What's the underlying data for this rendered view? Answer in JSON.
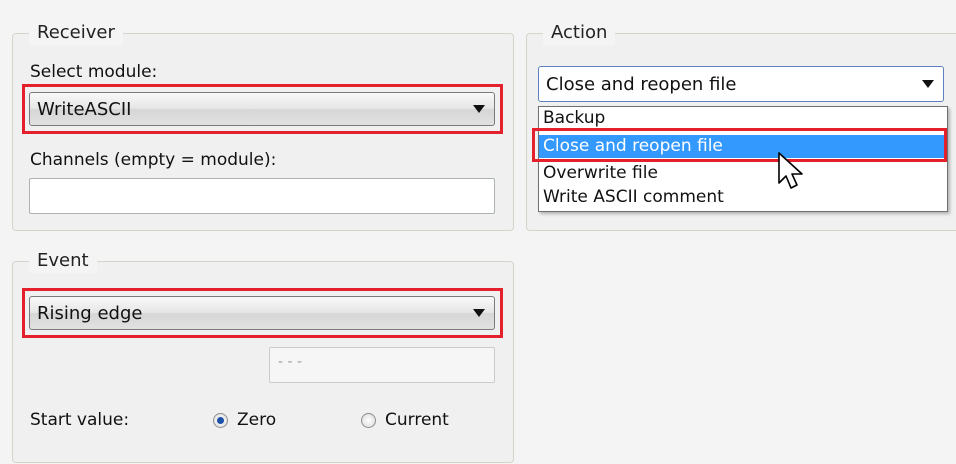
{
  "receiver": {
    "title": "Receiver",
    "select_module_label": "Select module:",
    "module_value": "WriteASCII",
    "channels_label": "Channels (empty = module):",
    "channels_value": ""
  },
  "action": {
    "title": "Action",
    "selected": "Close and reopen file",
    "options": [
      "Backup",
      "Close and reopen file",
      "Overwrite file",
      "Write ASCII comment"
    ]
  },
  "event": {
    "title": "Event",
    "event_value": "Rising edge",
    "disabled_field": "- - -",
    "start_value_label": "Start value:",
    "radio_zero": "Zero",
    "radio_current": "Current",
    "radio_selected": "Zero"
  },
  "colors": {
    "highlight": "#e4202c",
    "selection": "#3399ff"
  },
  "icons": {
    "dropdown": "chevron-down-icon",
    "cursor": "mouse-pointer-icon"
  }
}
